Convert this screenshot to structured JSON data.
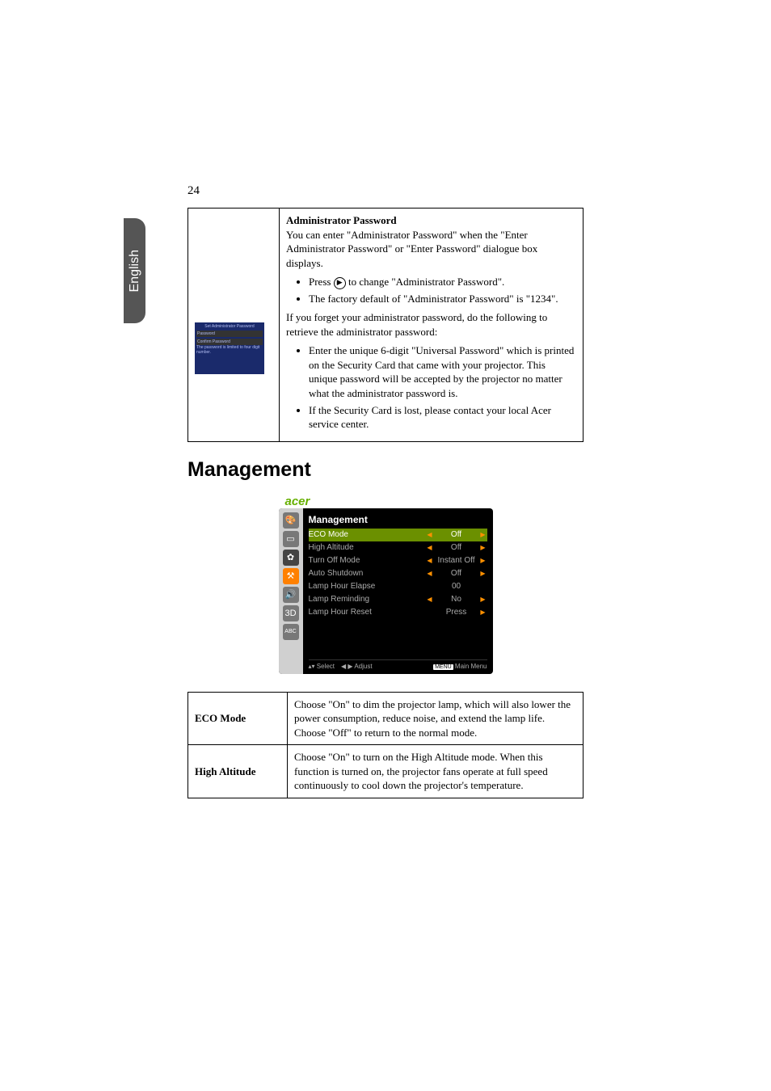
{
  "page_number": "24",
  "side_tab": "English",
  "sec": {
    "heading": "Administrator Password",
    "p1": "You can enter \"Administrator Password\" when the \"Enter Administrator Password\" or \"Enter Password\" dialogue box displays.",
    "b1a": "Press ",
    "b1b": " to change \"Administrator Password\".",
    "b2": "The factory default of \"Administrator Password\" is \"1234\".",
    "p2": "If you forget your administrator password, do the following to retrieve the administrator password:",
    "b3": "Enter the unique 6-digit \"Universal Password\" which is printed on the Security Card that came with your projector. This unique password will be accepted by the projector no matter what the administrator password is.",
    "b4": "If the Security Card is lost, please contact your local Acer service center.",
    "thumb": {
      "t": "Set Administrator Password",
      "r1": "Password",
      "r2": "Confirm Password",
      "r3": "The password is limited to four digit number."
    }
  },
  "mgmt_heading": "Management",
  "osd": {
    "brand": "acer",
    "title": "Management",
    "rows": [
      {
        "k": "ECO Mode",
        "v": "Off",
        "l": "◀",
        "r": "▶"
      },
      {
        "k": "High Altitude",
        "v": "Off",
        "l": "◀",
        "r": "▶"
      },
      {
        "k": "Turn Off Mode",
        "v": "Instant Off",
        "l": "◀",
        "r": "▶"
      },
      {
        "k": "Auto Shutdown",
        "v": "Off",
        "l": "◀",
        "r": "▶"
      },
      {
        "k": "Lamp Hour Elapse",
        "v": "00",
        "l": "",
        "r": ""
      },
      {
        "k": "Lamp Reminding",
        "v": "No",
        "l": "◀",
        "r": "▶"
      },
      {
        "k": "Lamp Hour Reset",
        "v": "Press",
        "l": "",
        "r": "▶"
      }
    ],
    "foot": {
      "sel": "Select",
      "adj": "Adjust",
      "menu": "Main Menu",
      "mk": "MENU"
    }
  },
  "table": {
    "r1k": "ECO Mode",
    "r1v": "Choose \"On\" to dim the projector lamp, which will also lower the power consumption, reduce noise, and extend the lamp life. Choose \"Off\" to return to the normal mode.",
    "r2k": "High Altitude",
    "r2v": "Choose \"On\" to turn on the High Altitude mode. When this function is turned on, the projector fans operate at full speed continuously to cool down the projector's temperature."
  }
}
